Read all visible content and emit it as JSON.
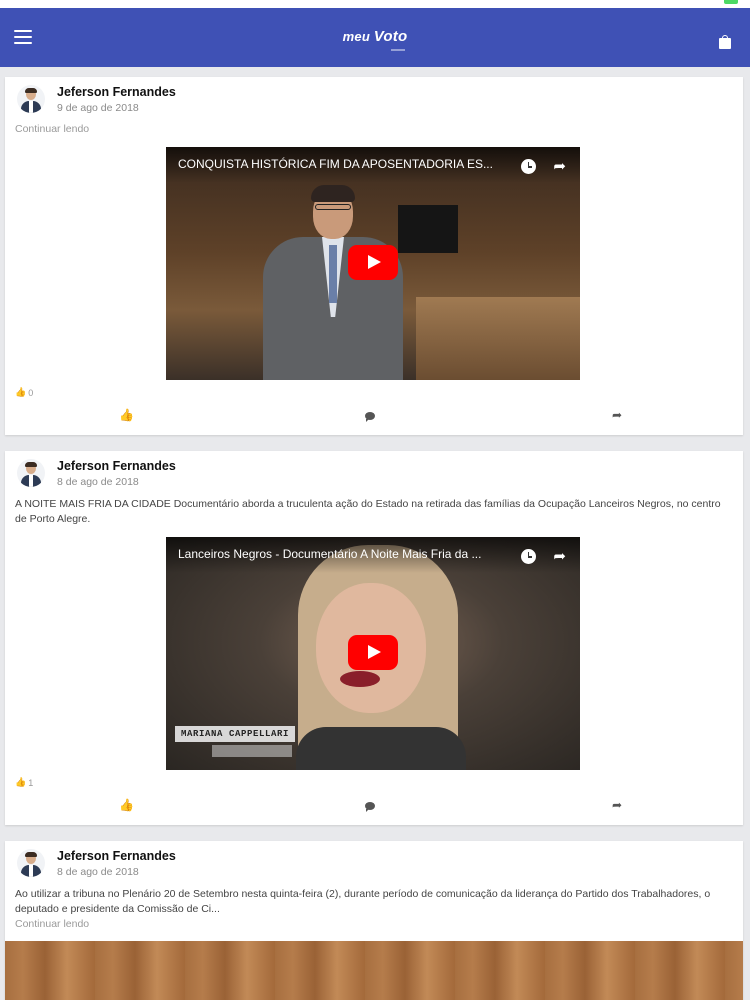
{
  "app": {
    "brand_prefix": "meu",
    "brand_name": "Voto",
    "colors": {
      "appbar": "#3f51b5",
      "like_blue": "#3b7be0",
      "play_red": "#ff0000"
    }
  },
  "icons": {
    "menu": "hamburger-menu-icon",
    "bag": "shopping-bag-icon",
    "like": "thumbs-up-icon",
    "comment": "comment-bubble-icon",
    "share": "share-arrow-icon"
  },
  "posts": [
    {
      "author": "Jeferson Fernandes",
      "date": "9 de ago de 2018",
      "read_more": "Continuar lendo",
      "video_title": "CONQUISTA HISTÓRICA FIM DA APOSENTADORIA ES...",
      "likes": "0"
    },
    {
      "author": "Jeferson Fernandes",
      "date": "8 de ago de 2018",
      "text": "A NOITE MAIS FRIA DA CIDADE Documentário aborda a truculenta ação do Estado na retirada das famílias da Ocupação Lanceiros Negros, no centro de Porto Alegre.",
      "video_title": "Lanceiros Negros - Documentário A Noite Mais Fria da ...",
      "video_caption": "MARIANA CAPPELLARI",
      "likes": "1"
    },
    {
      "author": "Jeferson Fernandes",
      "date": "8 de ago de 2018",
      "text": "Ao utilizar a tribuna no Plenário 20 de Setembro nesta quinta-feira (2), durante período de comunicação da liderança do Partido dos Trabalhadores, o deputado e presidente da Comissão de Ci...",
      "read_more": "Continuar lendo"
    }
  ]
}
